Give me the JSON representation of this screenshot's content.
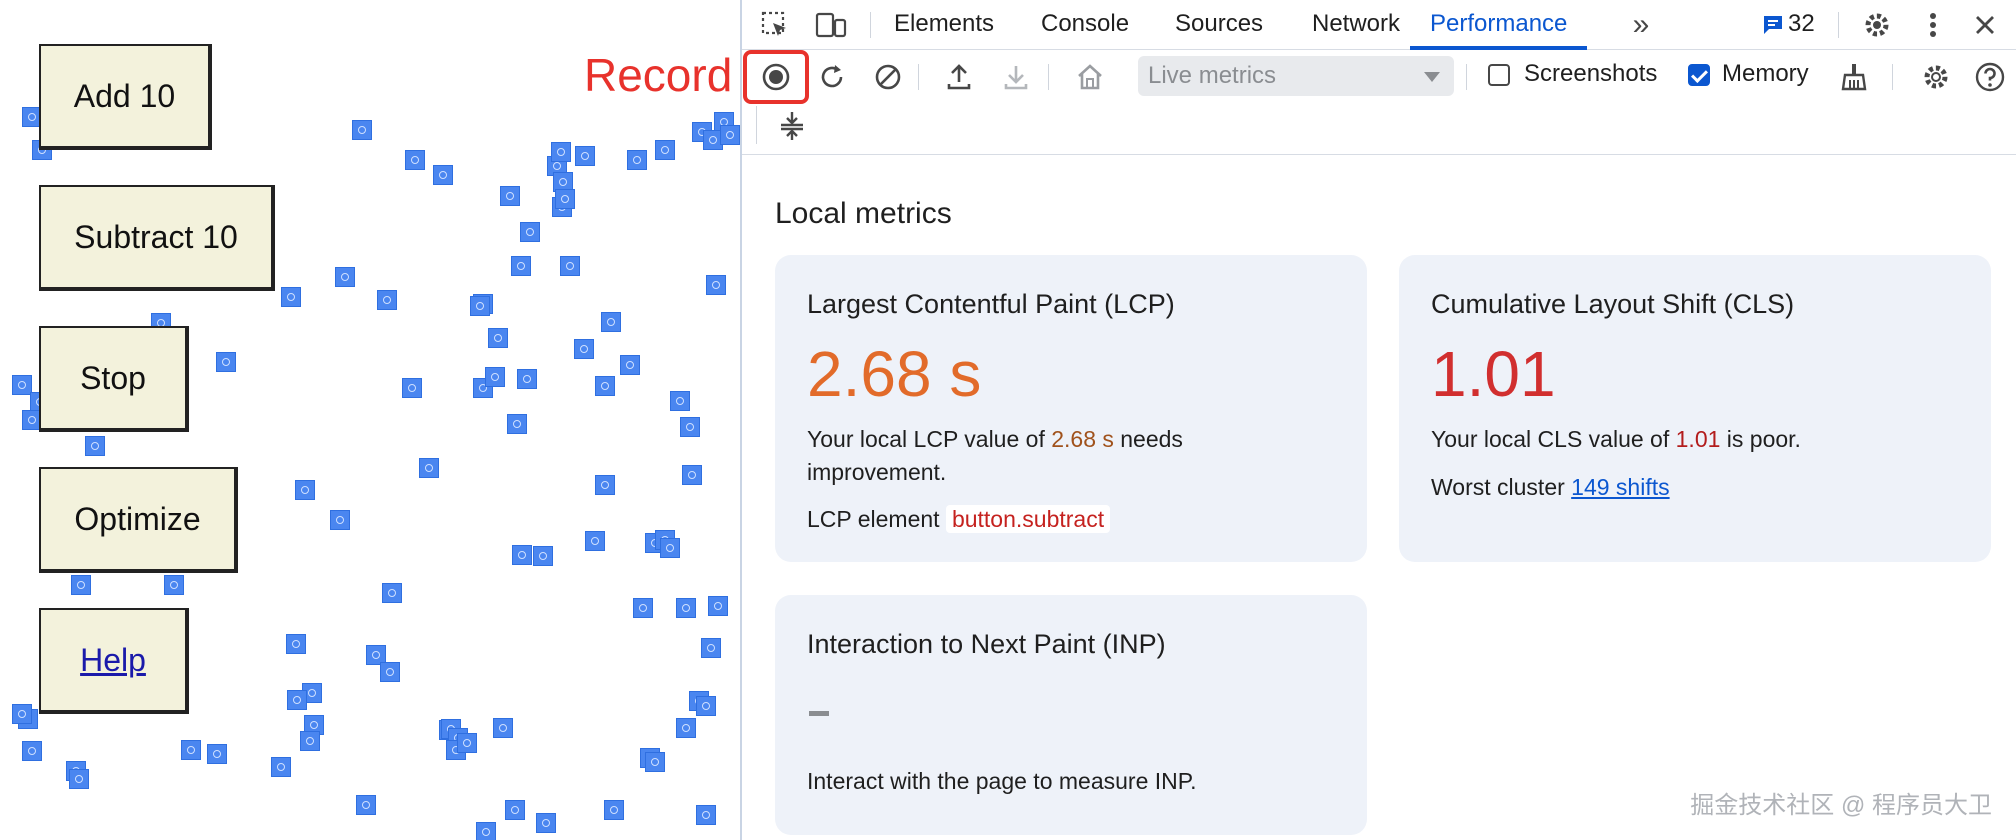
{
  "demo_page": {
    "buttons": {
      "add": "Add 10",
      "subtract": "Subtract 10",
      "stop": "Stop",
      "optimize": "Optimize",
      "help": "Help"
    },
    "record_callout": "Record"
  },
  "devtools": {
    "tabs": [
      "Elements",
      "Console",
      "Sources",
      "Network",
      "Performance"
    ],
    "active_tab": "Performance",
    "issues_count": "32",
    "toolbar": {
      "live_metrics_placeholder": "Live metrics",
      "screenshots_label": "Screenshots",
      "screenshots_checked": false,
      "memory_label": "Memory",
      "memory_checked": true
    },
    "local_metrics": {
      "title": "Local metrics",
      "lcp": {
        "title": "Largest Contentful Paint (LCP)",
        "value": "2.68 s",
        "text_prefix": "Your local LCP value of ",
        "text_value": "2.68 s",
        "text_suffix": " needs",
        "text_line2": "improvement.",
        "element_label": "LCP element",
        "element_value": "button.subtract"
      },
      "cls": {
        "title": "Cumulative Layout Shift (CLS)",
        "value": "1.01",
        "text_prefix": "Your local CLS value of ",
        "text_value": "1.01",
        "text_suffix": " is poor.",
        "worst_label": "Worst cluster ",
        "worst_link": "149 shifts"
      },
      "inp": {
        "title": "Interaction to Next Paint (INP)",
        "text": "Interact with the page to measure INP."
      }
    }
  },
  "colors": {
    "accent": "#0b57d0",
    "lcp": "#e26b2a",
    "cls": "#d12f2f",
    "record": "#e8322c"
  },
  "watermark": "掘金技术社区 @ 程序员大卫"
}
